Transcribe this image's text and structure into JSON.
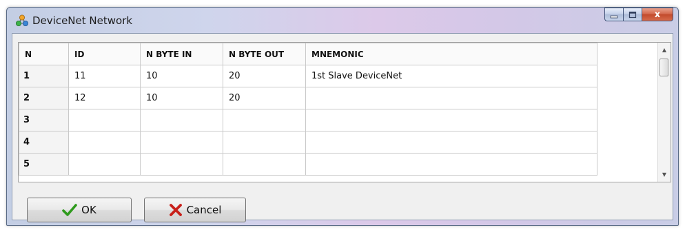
{
  "window": {
    "title": "DeviceNet Network",
    "close_glyph": "x"
  },
  "grid": {
    "columns": [
      "N",
      "ID",
      "N BYTE IN",
      "N BYTE OUT",
      "MNEMONIC"
    ],
    "rows": [
      {
        "n": "1",
        "id": "11",
        "byte_in": "10",
        "byte_out": "20",
        "mnemonic": "1st Slave DeviceNet"
      },
      {
        "n": "2",
        "id": "12",
        "byte_in": "10",
        "byte_out": "20",
        "mnemonic": ""
      },
      {
        "n": "3",
        "id": "",
        "byte_in": "",
        "byte_out": "",
        "mnemonic": ""
      },
      {
        "n": "4",
        "id": "",
        "byte_in": "",
        "byte_out": "",
        "mnemonic": ""
      },
      {
        "n": "5",
        "id": "",
        "byte_in": "",
        "byte_out": "",
        "mnemonic": ""
      }
    ]
  },
  "buttons": {
    "ok_label": "OK",
    "cancel_label": "Cancel"
  },
  "icons": {
    "app": "network-nodes-icon",
    "ok": "checkmark-icon",
    "cancel": "x-icon"
  },
  "colors": {
    "ok_check": "#2e9a1c",
    "cancel_x": "#c8201a",
    "close_button": "#c24a2c"
  }
}
